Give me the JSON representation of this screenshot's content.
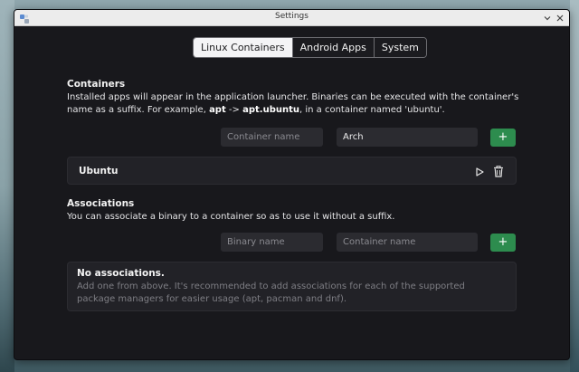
{
  "window": {
    "title": "Settings",
    "colors": {
      "accent": "#2d8c4e",
      "background": "#18181c",
      "titlebar": "#ececec"
    }
  },
  "tabs": [
    {
      "label": "Linux Containers",
      "active": true
    },
    {
      "label": "Android Apps",
      "active": false
    },
    {
      "label": "System",
      "active": false
    }
  ],
  "containers": {
    "title": "Containers",
    "desc_part1": "Installed apps will appear in the application launcher. Binaries can be executed with the container's name as a suffix. For example, ",
    "example_cmd": "apt",
    "arrow": " -> ",
    "example_suffixed": "apt.ubuntu",
    "desc_part2": ", in a container named 'ubuntu'.",
    "name_placeholder": "Container name",
    "distro_value": "Arch",
    "add_label": "+",
    "items": [
      {
        "name": "Ubuntu"
      }
    ]
  },
  "associations": {
    "title": "Associations",
    "desc": "You can associate a binary to a container so as to use it without a suffix.",
    "binary_placeholder": "Binary name",
    "container_placeholder": "Container name",
    "add_label": "+",
    "empty_title": "No associations.",
    "empty_desc": "Add one from above. It's recommended to add associations for each of the supported package managers for easier usage (apt, pacman and dnf)."
  }
}
